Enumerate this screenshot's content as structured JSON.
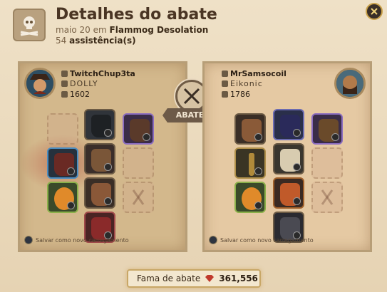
{
  "header": {
    "title": "Detalhes do abate",
    "date_prefix": "maio 20 em",
    "location": "Flammog Desolation",
    "assists_count": "54",
    "assists_label": "assistência(s)"
  },
  "close_icon": "close-icon",
  "killer": {
    "name": "TwitchChup3ta",
    "guild": "DOLLY",
    "ip": "1602",
    "save_label": "Salvar como novo carregamento"
  },
  "victim": {
    "name": "MrSamsocoil",
    "guild": "Eikonic",
    "ip": "1786",
    "save_label": "Salvar como novo carregamento"
  },
  "kill_label": "ABATEU",
  "fame": {
    "label": "Fama de abate",
    "value": "361,556"
  },
  "colors": {
    "accent_gold": "#c8a767",
    "fame_icon": "#c0392b",
    "parchment": "#e6d3b3"
  }
}
